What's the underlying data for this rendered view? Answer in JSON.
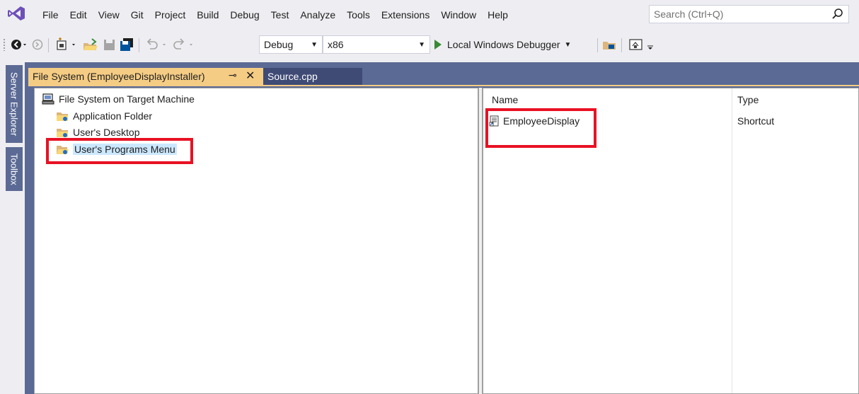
{
  "menu": {
    "items": [
      {
        "label": "File"
      },
      {
        "label": "Edit"
      },
      {
        "label": "View"
      },
      {
        "label": "Git"
      },
      {
        "label": "Project"
      },
      {
        "label": "Build"
      },
      {
        "label": "Debug"
      },
      {
        "label": "Test"
      },
      {
        "label": "Analyze"
      },
      {
        "label": "Tools"
      },
      {
        "label": "Extensions"
      },
      {
        "label": "Window"
      },
      {
        "label": "Help"
      }
    ],
    "search_placeholder": "Search (Ctrl+Q)"
  },
  "toolbar": {
    "configuration": "Debug",
    "platform": "x86",
    "run_label": "Local Windows Debugger",
    "icons": [
      "back-icon",
      "forward-icon",
      "new-project-icon",
      "open-icon",
      "save-icon",
      "save-all-icon",
      "undo-icon",
      "redo-icon",
      "find-in-files-icon",
      "browser-link-icon"
    ]
  },
  "side_tabs": {
    "server_explorer": "Server Explorer",
    "toolbox": "Toolbox"
  },
  "tabs": {
    "active": "File System (EmployeeDisplayInstaller)",
    "inactive": "Source.cpp"
  },
  "tree": {
    "root": "File System on Target Machine",
    "children": [
      {
        "label": "Application Folder"
      },
      {
        "label": "User's Desktop"
      },
      {
        "label": "User's Programs Menu",
        "selected": true
      }
    ]
  },
  "list": {
    "columns": [
      "Name",
      "Type"
    ],
    "rows": [
      {
        "name": "EmployeeDisplay",
        "type": "Shortcut"
      }
    ]
  },
  "colors": {
    "accent_tab": "#f5cc84",
    "doc_well": "#5b6a94",
    "highlight": "#e81123",
    "selection": "#cce8ff"
  }
}
